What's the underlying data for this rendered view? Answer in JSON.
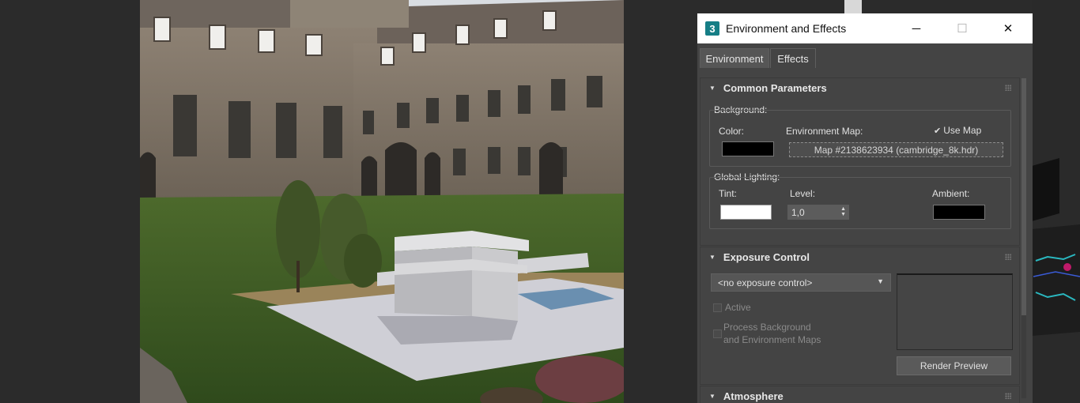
{
  "dialog": {
    "title": "Environment and Effects",
    "app_icon_text": "3",
    "window_buttons": {
      "minimize": "─",
      "maximize": "☐",
      "close": "✕"
    },
    "tabs": [
      {
        "label": "Environment",
        "active": true
      },
      {
        "label": "Effects",
        "active": false
      }
    ]
  },
  "common_parameters": {
    "header": "Common Parameters",
    "background_group": "Background:",
    "color_label": "Color:",
    "env_map_label": "Environment Map:",
    "use_map_label": "Use Map",
    "use_map_checked": true,
    "use_map_check_glyph": "✔",
    "env_map_button": "Map #2138623934 (cambridge_8k.hdr)",
    "background_color": "#000000",
    "global_lighting_group": "Global Lighting:",
    "tint_label": "Tint:",
    "tint_color": "#ffffff",
    "level_label": "Level:",
    "level_value": "1,0",
    "ambient_label": "Ambient:",
    "ambient_color": "#000000"
  },
  "exposure_control": {
    "header": "Exposure Control",
    "selected": "<no exposure control>",
    "active_label": "Active",
    "process_bg_label_line1": "Process Background",
    "process_bg_label_line2": "and Environment Maps",
    "render_preview_button": "Render Preview"
  },
  "atmosphere": {
    "header": "Atmosphere"
  },
  "colors": {
    "dialog_bg": "#444444",
    "titlebar_bg": "#ffffff",
    "accent_icon": "#167e86"
  }
}
